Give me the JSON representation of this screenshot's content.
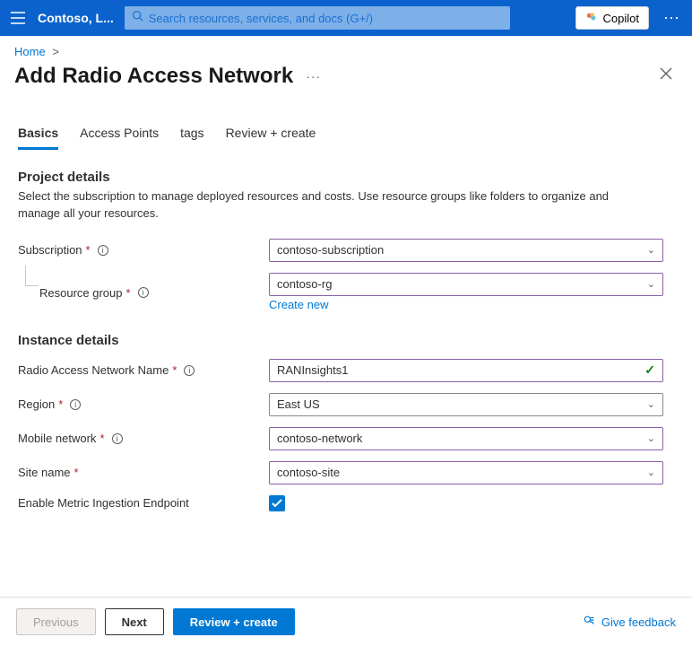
{
  "header": {
    "tenant": "Contoso, L...",
    "search_placeholder": "Search resources, services, and docs (G+/)",
    "copilot": "Copilot"
  },
  "breadcrumb": {
    "home": "Home"
  },
  "page": {
    "title": "Add Radio Access Network"
  },
  "tabs": [
    {
      "label": "Basics"
    },
    {
      "label": "Access Points"
    },
    {
      "label": "tags"
    },
    {
      "label": "Review + create"
    }
  ],
  "project_details": {
    "heading": "Project details",
    "description": "Select the subscription to manage deployed resources and costs. Use resource groups like folders to organize and manage all your resources.",
    "subscription_label": "Subscription",
    "subscription_value": "contoso-subscription",
    "resource_group_label": "Resource group",
    "resource_group_value": "contoso-rg",
    "create_new": "Create new"
  },
  "instance_details": {
    "heading": "Instance details",
    "ran_name_label": "Radio Access Network Name",
    "ran_name_value": "RANInsights1",
    "region_label": "Region",
    "region_value": "East US",
    "mobile_network_label": "Mobile network",
    "mobile_network_value": "contoso-network",
    "site_name_label": "Site name",
    "site_name_value": "contoso-site",
    "enable_metric_label": "Enable Metric Ingestion Endpoint",
    "enable_metric_checked": true
  },
  "footer": {
    "previous": "Previous",
    "next": "Next",
    "review_create": "Review + create",
    "feedback": "Give feedback"
  }
}
